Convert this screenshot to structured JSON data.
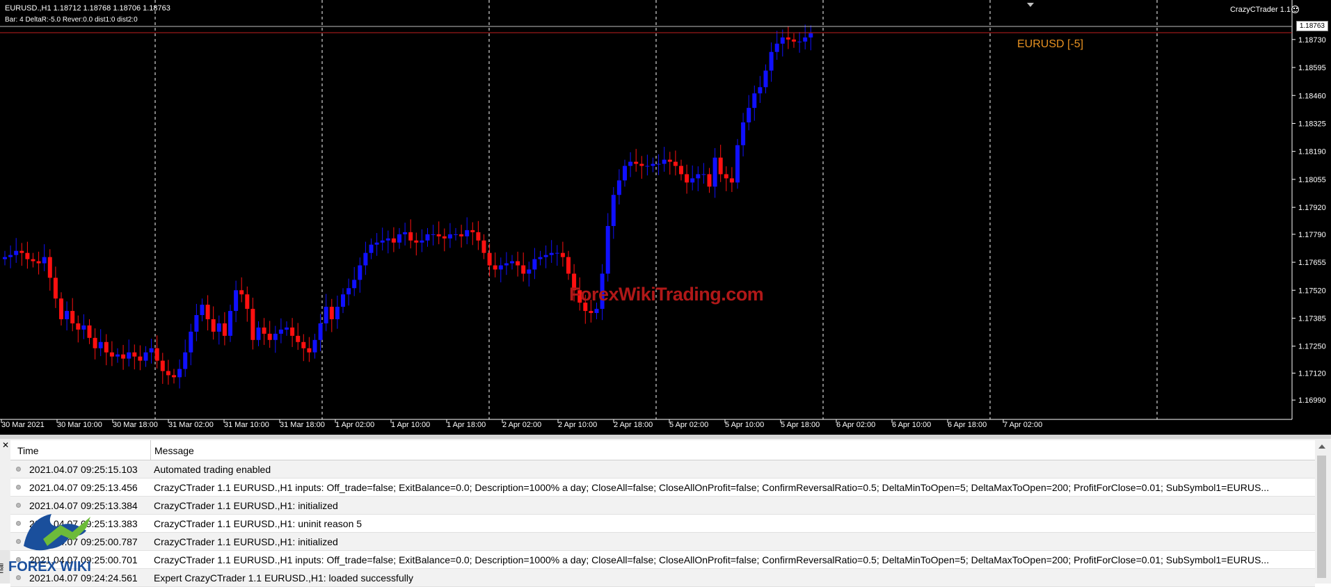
{
  "chart": {
    "symbol_info": "EURUSD.,H1  1.18712 1.18768 1.18706 1.18763",
    "indicator_info": "Bar: 4 DeltaR:-5.0 Rever:0.0 dist1:0 dist2:0",
    "ea_name": "CrazyCTrader 1.1",
    "current_price": "1.18763",
    "position_label": "EURUSD [-5]",
    "watermark": "ForexWikiTrading.com",
    "colors": {
      "background": "#000000",
      "bull": "#1010ff",
      "bear": "#ff1010",
      "grid": "#ffffff",
      "price_line": "#c02020"
    }
  },
  "chart_data": {
    "type": "candlestick",
    "ylim": [
      1.169,
      1.1882
    ],
    "y_ticks": [
      "1.18730",
      "1.18595",
      "1.18460",
      "1.18325",
      "1.18190",
      "1.18055",
      "1.17920",
      "1.17790",
      "1.17655",
      "1.17520",
      "1.17385",
      "1.17250",
      "1.17120",
      "1.16990"
    ],
    "x_ticks": [
      "30 Mar 2021",
      "30 Mar 10:00",
      "30 Mar 18:00",
      "31 Mar 02:00",
      "31 Mar 10:00",
      "31 Mar 18:00",
      "1 Apr 02:00",
      "1 Apr 10:00",
      "1 Apr 18:00",
      "2 Apr 02:00",
      "2 Apr 10:00",
      "2 Apr 18:00",
      "5 Apr 02:00",
      "5 Apr 10:00",
      "5 Apr 18:00",
      "6 Apr 02:00",
      "6 Apr 10:00",
      "6 Apr 18:00",
      "7 Apr 02:00"
    ],
    "closes": [
      1.1768,
      1.1769,
      1.1771,
      1.177,
      1.1767,
      1.1766,
      1.1765,
      1.1768,
      1.1758,
      1.1748,
      1.1738,
      1.1742,
      1.1736,
      1.1733,
      1.1735,
      1.1729,
      1.1724,
      1.1727,
      1.1722,
      1.172,
      1.1721,
      1.1719,
      1.1722,
      1.172,
      1.1718,
      1.1722,
      1.1724,
      1.1718,
      1.1713,
      1.1711,
      1.171,
      1.1714,
      1.1722,
      1.1732,
      1.174,
      1.1745,
      1.1738,
      1.1732,
      1.1736,
      1.173,
      1.1742,
      1.1752,
      1.175,
      1.1743,
      1.1728,
      1.1734,
      1.1731,
      1.1728,
      1.1731,
      1.1733,
      1.1734,
      1.173,
      1.1727,
      1.1724,
      1.1722,
      1.1728,
      1.1736,
      1.1744,
      1.1738,
      1.1744,
      1.175,
      1.1753,
      1.1757,
      1.1764,
      1.177,
      1.1774,
      1.1775,
      1.1776,
      1.1777,
      1.1775,
      1.1779,
      1.178,
      1.1776,
      1.1775,
      1.1776,
      1.1779,
      1.1779,
      1.1778,
      1.1777,
      1.1779,
      1.1779,
      1.1778,
      1.1781,
      1.178,
      1.1776,
      1.177,
      1.1764,
      1.1762,
      1.1764,
      1.1765,
      1.1766,
      1.1764,
      1.176,
      1.1762,
      1.1767,
      1.1768,
      1.1769,
      1.177,
      1.177,
      1.1768,
      1.176,
      1.1752,
      1.1746,
      1.1742,
      1.1741,
      1.1743,
      1.176,
      1.1783,
      1.1798,
      1.1805,
      1.1812,
      1.1814,
      1.1813,
      1.1812,
      1.1812,
      1.1813,
      1.1813,
      1.1815,
      1.1814,
      1.1812,
      1.1808,
      1.1804,
      1.1806,
      1.1808,
      1.1808,
      1.1802,
      1.1816,
      1.1808,
      1.1806,
      1.1804,
      1.1822,
      1.1833,
      1.184,
      1.1847,
      1.185,
      1.1858,
      1.1867,
      1.1871,
      1.1874,
      1.1873,
      1.1872,
      1.1872,
      1.1874,
      1.1876
    ]
  },
  "terminal": {
    "columns": [
      "Time",
      "Message"
    ],
    "rows": [
      {
        "time": "2021.04.07 09:25:15.103",
        "message": "Automated trading enabled"
      },
      {
        "time": "2021.04.07 09:25:13.456",
        "message": "CrazyCTrader 1.1 EURUSD.,H1 inputs: Off_trade=false; ExitBalance=0.0; Description=1000% a day; CloseAll=false; CloseAllOnProfit=false; ConfirmReversalRatio=0.5; DeltaMinToOpen=5; DeltaMaxToOpen=200; ProfitForClose=0.01; SubSymbol1=EURUS..."
      },
      {
        "time": "2021.04.07 09:25:13.384",
        "message": "CrazyCTrader 1.1 EURUSD.,H1: initialized"
      },
      {
        "time": "2021.04.07 09:25:13.383",
        "message": "CrazyCTrader 1.1 EURUSD.,H1: uninit reason 5"
      },
      {
        "time": "2021.04.07 09:25:00.787",
        "message": "CrazyCTrader 1.1 EURUSD.,H1: initialized"
      },
      {
        "time": "2021.04.07 09:25:00.701",
        "message": "CrazyCTrader 1.1 EURUSD.,H1 inputs: Off_trade=false; ExitBalance=0.0; Description=1000% a day; CloseAll=false; CloseAllOnProfit=false; ConfirmReversalRatio=0.5; DeltaMinToOpen=5; DeltaMaxToOpen=200; ProfitForClose=0.01; SubSymbol1=EURUS..."
      },
      {
        "time": "2021.04.07 09:24:24.561",
        "message": "Expert CrazyCTrader 1.1 EURUSD.,H1: loaded successfully"
      }
    ],
    "side_tab": "nal"
  },
  "logo": {
    "text_main": "FOREX WIKI"
  }
}
